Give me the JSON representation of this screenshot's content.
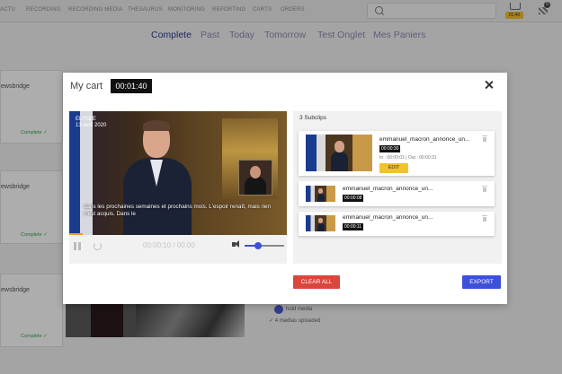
{
  "topnav": {
    "items": [
      "ACTU",
      "RECORDING",
      "RECORDING MEDIA",
      "THESAURUS",
      "MONITORING",
      "REPORTING",
      "CARTS",
      "ORDERS"
    ],
    "cart_badge": "01:40",
    "flag_badge": "0"
  },
  "tabs": [
    "Complete",
    "Past",
    "Today",
    "Tomorrow",
    "Test Onglet",
    "Mes Paniers"
  ],
  "background_cards": [
    {
      "title": "ewsbridge",
      "status": "Complete ✓"
    },
    {
      "title": "ewsbridge",
      "status": "Complete ✓"
    },
    {
      "title": "ewsbridge",
      "status": "Complete ✓"
    }
  ],
  "upload_info": {
    "line1": "hold media",
    "line2": "✓ 4 medias uploaded"
  },
  "modal": {
    "title": "My cart",
    "timer": "00:01:40",
    "video": {
      "logo_text": [
        "ELYSEE",
        "13 avril 2020"
      ],
      "subtitle": "dans les prochaines semaines et prochains mois. L'espoir renaît, mais rien n'est acquis. Dans le",
      "time_text": "00:00:10 / 00:00",
      "volume_level": 0.35,
      "progress": 0.06
    },
    "subclips": {
      "count_label": "3 Subclips",
      "items": [
        {
          "name": "emmanuel_macron_annonce_un...",
          "duration": "00:00:30",
          "in_out": "In : 00:00:01  |  Out : 00:00:31",
          "edit_label": "EDIT"
        },
        {
          "name": "emmanuel_macron_annonce_un...",
          "duration": "00:00:08"
        },
        {
          "name": "emmanuel_macron_annonce_un...",
          "duration": "00:00:11"
        }
      ]
    },
    "clear_label": "CLEAR ALL",
    "export_label": "EXPORT"
  },
  "colors": {
    "accent": "#3d50d8",
    "danger": "#d9473c",
    "warning": "#f2c12e",
    "success": "#3aa24a"
  }
}
